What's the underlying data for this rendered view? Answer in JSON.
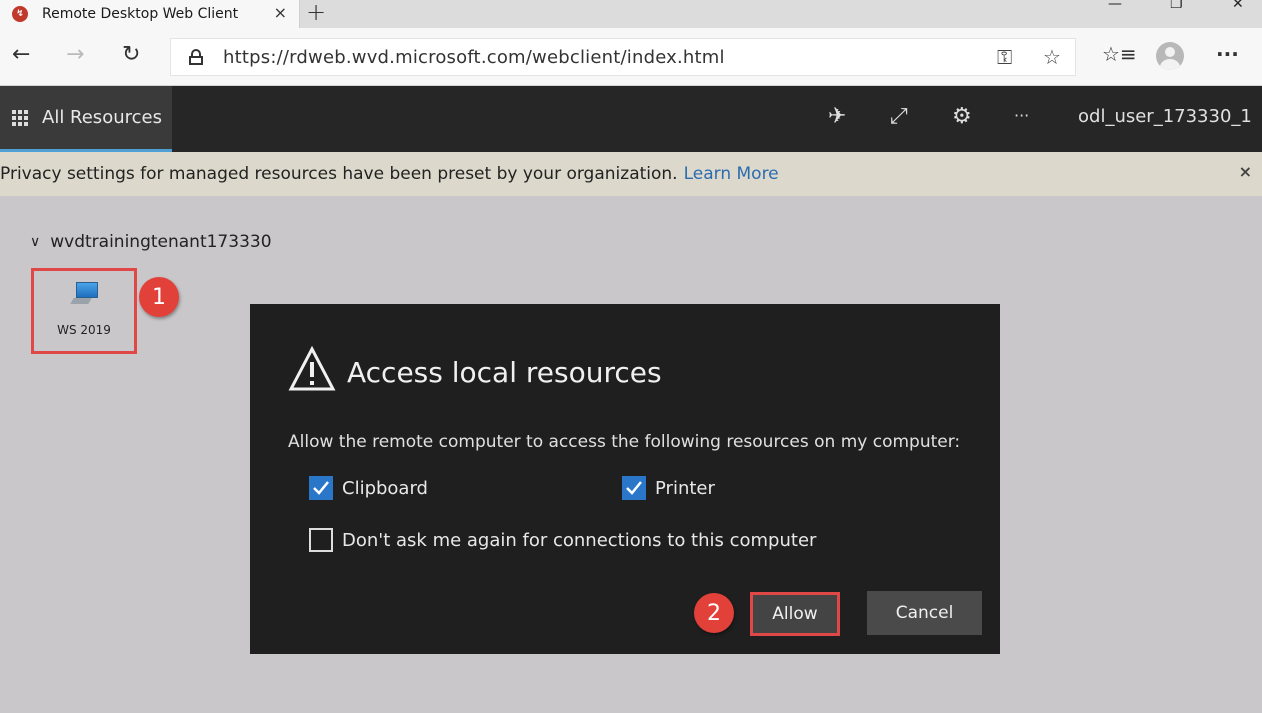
{
  "browser": {
    "tab_title": "Remote Desktop Web Client",
    "tab_close": "×",
    "new_tab": "+",
    "minimize": "—",
    "restore": "❐",
    "close_window": "✕",
    "url": "https://rdweb.wvd.microsoft.com/webclient/index.html",
    "icons": {
      "back": "←",
      "forward": "→",
      "refresh": "↻",
      "key": "⚿",
      "favorite": "☆",
      "favorites_list": "☆≡"
    }
  },
  "app_header": {
    "all_resources_label": "All Resources",
    "username": "odl_user_173330_1",
    "icons": {
      "pin": "✈",
      "fullscreen": "⤢",
      "settings": "⚙",
      "more": "···"
    }
  },
  "banner": {
    "text": "Privacy settings for managed resources have been preset by your organization.",
    "link": "Learn More",
    "close": "×"
  },
  "content": {
    "tenant_name": "wvdtrainingtenant173330",
    "chevron": "∨",
    "resource_label": "WS 2019"
  },
  "steps": {
    "step1": "1",
    "step2": "2"
  },
  "dialog": {
    "title": "Access local resources",
    "message": "Allow the remote computer to access the following resources on my computer:",
    "options": [
      {
        "label": "Clipboard",
        "checked": true
      },
      {
        "label": "Printer",
        "checked": true
      },
      {
        "label": "Don't ask me again for connections to this computer",
        "checked": false
      }
    ],
    "allow_label": "Allow",
    "cancel_label": "Cancel"
  },
  "colors": {
    "accent_blue": "#2a76c9",
    "highlight_red": "#e04848",
    "dialog_bg": "#1f1f1f",
    "header_bg": "#262626"
  }
}
